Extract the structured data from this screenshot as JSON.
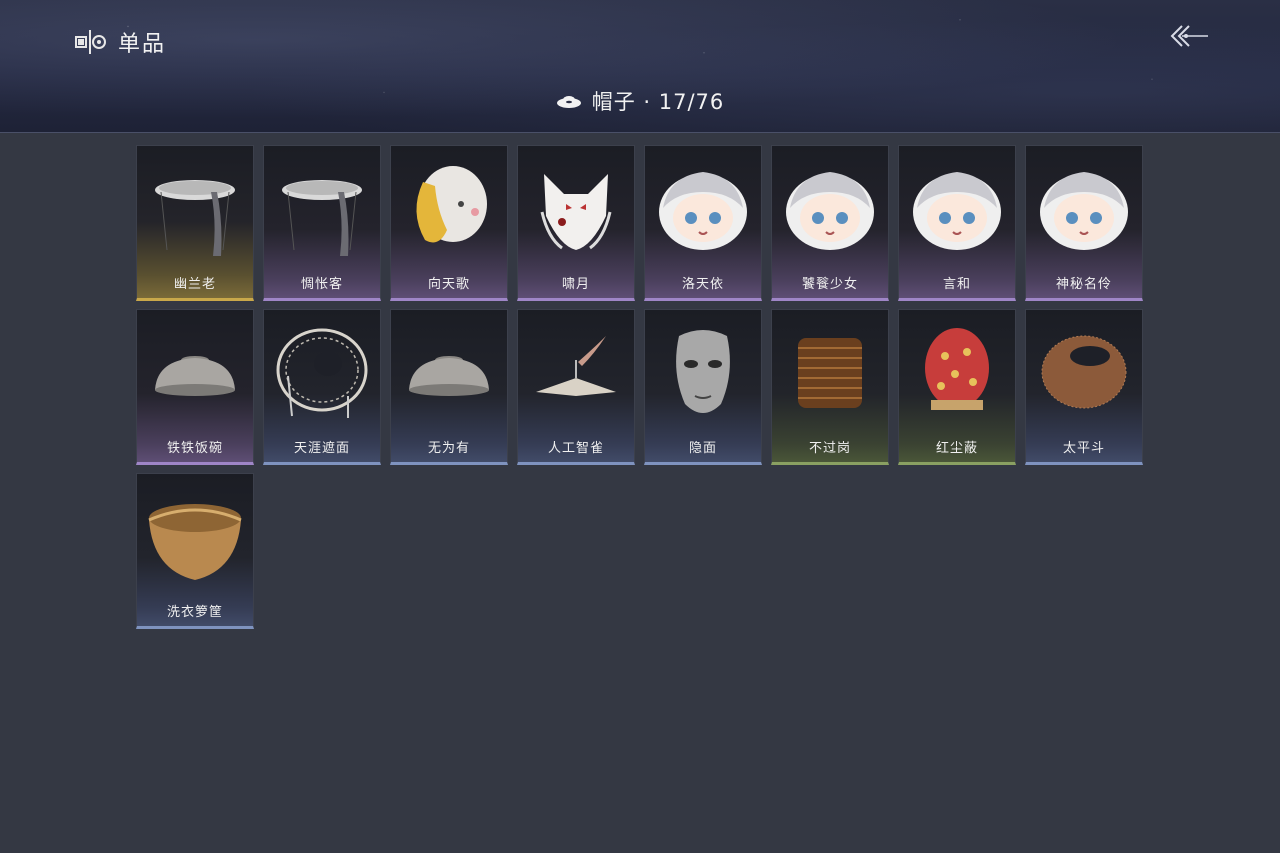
{
  "header": {
    "title": "单品",
    "title_icon": "collection-icon",
    "back_icon": "back-arrow-icon"
  },
  "category": {
    "label": "帽子 · 17/76",
    "icon": "hat-icon"
  },
  "items": [
    {
      "name": "幽兰老",
      "rarity": "gold",
      "icon": "hat-veil-icon"
    },
    {
      "name": "惆怅客",
      "rarity": "purple",
      "icon": "hat-veil-icon"
    },
    {
      "name": "向天歌",
      "rarity": "purple",
      "icon": "chick-hood-icon"
    },
    {
      "name": "啸月",
      "rarity": "purple",
      "icon": "fox-mask-icon"
    },
    {
      "name": "洛天依",
      "rarity": "purple",
      "icon": "character-head-icon"
    },
    {
      "name": "饕餮少女",
      "rarity": "purple",
      "icon": "character-head-icon"
    },
    {
      "name": "言和",
      "rarity": "purple",
      "icon": "character-head-icon"
    },
    {
      "name": "神秘名伶",
      "rarity": "purple",
      "icon": "character-head-icon"
    },
    {
      "name": "铁铁饭碗",
      "rarity": "purple",
      "icon": "bowl-hat-icon"
    },
    {
      "name": "天涯遮面",
      "rarity": "blue",
      "icon": "bamboo-hat-icon"
    },
    {
      "name": "无为有",
      "rarity": "blue",
      "icon": "bowl-hat-icon"
    },
    {
      "name": "人工智雀",
      "rarity": "blue",
      "icon": "conical-hat-icon"
    },
    {
      "name": "隐面",
      "rarity": "blue",
      "icon": "mask-icon"
    },
    {
      "name": "不过岗",
      "rarity": "green",
      "icon": "stacked-bowls-icon"
    },
    {
      "name": "红尘蔽",
      "rarity": "green",
      "icon": "red-hood-icon"
    },
    {
      "name": "太平斗",
      "rarity": "blue",
      "icon": "basket-hat-icon"
    },
    {
      "name": "洗衣箩筐",
      "rarity": "blue",
      "icon": "basket-icon"
    }
  ]
}
